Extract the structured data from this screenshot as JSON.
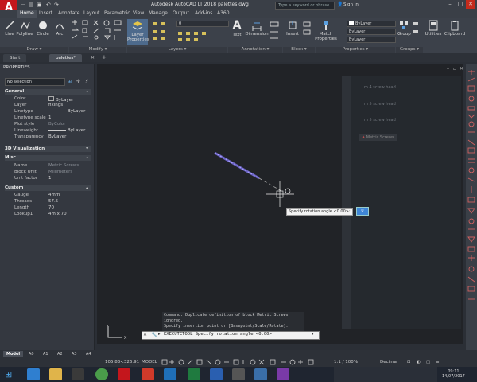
{
  "title_bar": {
    "logo_letter": "A",
    "logo_sub": "LT",
    "title": "Autodesk AutoCAD LT 2018    palettes.dwg",
    "search_placeholder": "Type a keyword or phrase",
    "sign_in": "Sign In"
  },
  "ribbon_tabs": [
    "Home",
    "Insert",
    "Annotate",
    "Layout",
    "Parametric",
    "View",
    "Manage",
    "Output",
    "Add-ins",
    "A360"
  ],
  "ribbon": {
    "draw": {
      "line": "Line",
      "polyline": "Polyline",
      "circle": "Circle",
      "arc": "Arc"
    },
    "layer_properties": "Layer\nProperties",
    "layer_value": "0",
    "text": "Text",
    "dimension": "Dimension",
    "insert": "Insert",
    "match_properties": "Match\nProperties",
    "bylayer": "ByLayer",
    "group": "Group",
    "utilities": "Utilities",
    "clipboard": "Clipboard",
    "panels": [
      "Draw",
      "Modify",
      "Layers",
      "Annotation",
      "Block",
      "Properties",
      "Groups"
    ]
  },
  "file_tabs": [
    "Start",
    "palettes*"
  ],
  "properties": {
    "title": "PROPERTIES",
    "selection": "No selection",
    "sections": [
      {
        "name": "General",
        "rows": [
          [
            "Color",
            "ByLayer"
          ],
          [
            "Layer",
            "fixings"
          ],
          [
            "Linetype",
            "ByLayer"
          ],
          [
            "Linetype scale",
            "1"
          ],
          [
            "Plot style",
            "ByColor"
          ],
          [
            "Lineweight",
            "ByLayer"
          ],
          [
            "Transparency",
            "ByLayer"
          ]
        ]
      },
      {
        "name": "3D Visualization",
        "rows": []
      },
      {
        "name": "Misc",
        "rows": [
          [
            "Name",
            "Metric Screws"
          ],
          [
            "Block Unit",
            "Millimeters"
          ],
          [
            "Unit factor",
            "1"
          ]
        ]
      },
      {
        "name": "Custom",
        "rows": [
          [
            "Gauge",
            "4mm"
          ],
          [
            "Threads",
            "57.5"
          ],
          [
            "Length",
            "70"
          ],
          [
            "Lookup1",
            "4m x 70"
          ]
        ]
      }
    ]
  },
  "tool_palette": {
    "items": [
      "m 4 screw head",
      "m 5 screw head",
      "m 5 screw head",
      "Metric Screws"
    ]
  },
  "command": {
    "history": [
      "Command:  Duplicate definition of block Metric Screws",
      "ignored.",
      "Specify insertion point or [Basepoint/Scale/Rotate]:"
    ],
    "prompt": "EXECUTETOOL Specify rotation angle <0.00>:",
    "tooltip": "Specify rotation angle <0.00>:",
    "tooltip_value": "0"
  },
  "layout_tabs": [
    "Model",
    "A0",
    "A1",
    "A2",
    "A3",
    "A4"
  ],
  "status": {
    "coords": "105.83<326.91",
    "space": "MODEL",
    "scale": "1:1 / 100%",
    "units": "Decimal"
  },
  "clock": {
    "time": "09:11",
    "date": "14/07/2017"
  }
}
